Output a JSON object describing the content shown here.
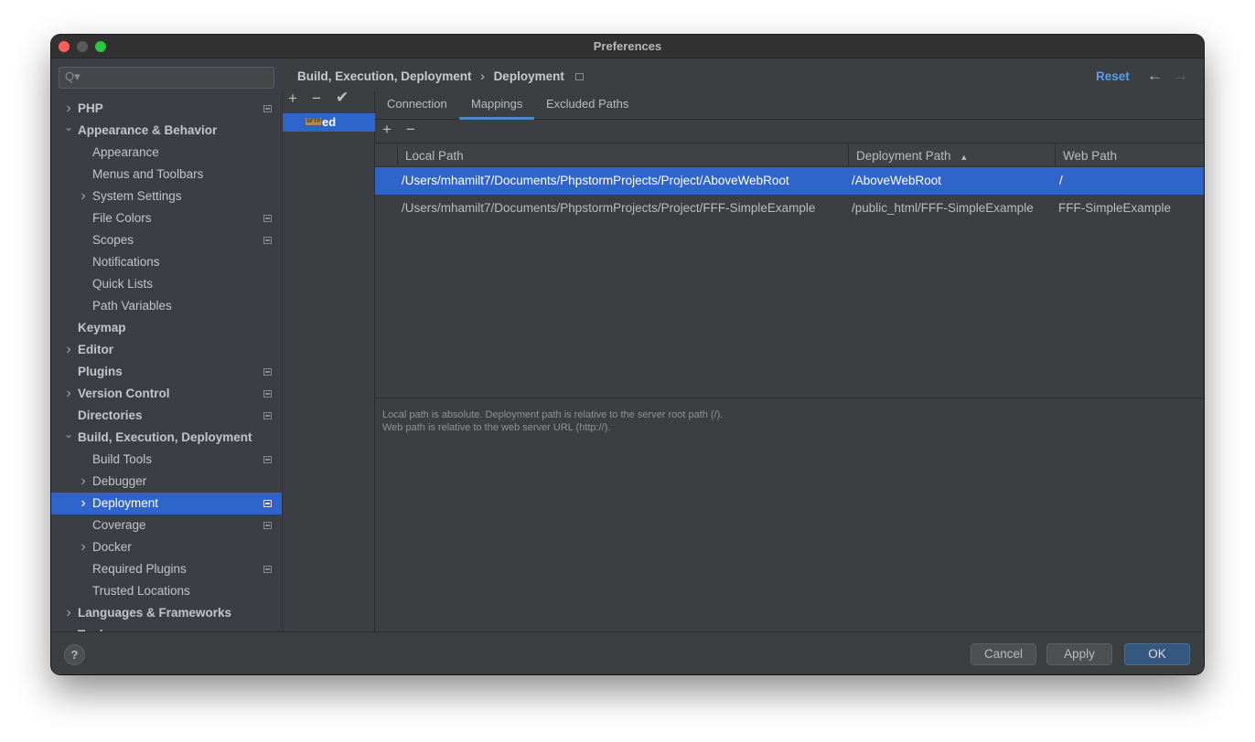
{
  "window": {
    "title": "Preferences"
  },
  "search": {
    "placeholder": "Q▾"
  },
  "sidebar": {
    "items": [
      {
        "label": "PHP",
        "level": 0,
        "arrow": ">",
        "bold": true,
        "badge": true
      },
      {
        "label": "Appearance & Behavior",
        "level": 0,
        "arrow": "v",
        "bold": true,
        "badge": false
      },
      {
        "label": "Appearance",
        "level": 1,
        "arrow": "",
        "bold": false,
        "badge": false
      },
      {
        "label": "Menus and Toolbars",
        "level": 1,
        "arrow": "",
        "bold": false,
        "badge": false
      },
      {
        "label": "System Settings",
        "level": 1,
        "arrow": ">",
        "bold": false,
        "badge": false
      },
      {
        "label": "File Colors",
        "level": 1,
        "arrow": "",
        "bold": false,
        "badge": true
      },
      {
        "label": "Scopes",
        "level": 1,
        "arrow": "",
        "bold": false,
        "badge": true
      },
      {
        "label": "Notifications",
        "level": 1,
        "arrow": "",
        "bold": false,
        "badge": false
      },
      {
        "label": "Quick Lists",
        "level": 1,
        "arrow": "",
        "bold": false,
        "badge": false
      },
      {
        "label": "Path Variables",
        "level": 1,
        "arrow": "",
        "bold": false,
        "badge": false
      },
      {
        "label": "Keymap",
        "level": 0,
        "arrow": "",
        "bold": true,
        "badge": false
      },
      {
        "label": "Editor",
        "level": 0,
        "arrow": ">",
        "bold": true,
        "badge": false
      },
      {
        "label": "Plugins",
        "level": 0,
        "arrow": "",
        "bold": true,
        "badge": true
      },
      {
        "label": "Version Control",
        "level": 0,
        "arrow": ">",
        "bold": true,
        "badge": true
      },
      {
        "label": "Directories",
        "level": 0,
        "arrow": "",
        "bold": true,
        "badge": true
      },
      {
        "label": "Build, Execution, Deployment",
        "level": 0,
        "arrow": "v",
        "bold": true,
        "badge": false
      },
      {
        "label": "Build Tools",
        "level": 1,
        "arrow": "",
        "bold": false,
        "badge": true
      },
      {
        "label": "Debugger",
        "level": 1,
        "arrow": ">",
        "bold": false,
        "badge": false
      },
      {
        "label": "Deployment",
        "level": 1,
        "arrow": ">",
        "bold": false,
        "badge": true,
        "selected": true
      },
      {
        "label": "Coverage",
        "level": 1,
        "arrow": "",
        "bold": false,
        "badge": true
      },
      {
        "label": "Docker",
        "level": 1,
        "arrow": ">",
        "bold": false,
        "badge": false
      },
      {
        "label": "Required Plugins",
        "level": 1,
        "arrow": "",
        "bold": false,
        "badge": true
      },
      {
        "label": "Trusted Locations",
        "level": 1,
        "arrow": "",
        "bold": false,
        "badge": false
      },
      {
        "label": "Languages & Frameworks",
        "level": 0,
        "arrow": ">",
        "bold": true,
        "badge": false
      },
      {
        "label": "Tools",
        "level": 0,
        "arrow": ">",
        "bold": true,
        "badge": false
      }
    ]
  },
  "breadcrumb": {
    "parent": "Build, Execution, Deployment",
    "sep": "›",
    "current": "Deployment"
  },
  "header": {
    "reset": "Reset",
    "back": "←",
    "forward": "→"
  },
  "servers": {
    "add": "+",
    "remove": "−",
    "default": "✔",
    "items": [
      {
        "name": "ed",
        "type": "SFTP"
      }
    ]
  },
  "tabs": [
    {
      "label": "Connection"
    },
    {
      "label": "Mappings",
      "active": true
    },
    {
      "label": "Excluded Paths"
    }
  ],
  "mappings": {
    "add": "+",
    "remove": "−",
    "columns": [
      "Local Path",
      "Deployment Path",
      "Web Path"
    ],
    "sort_indicator": "▲",
    "rows": [
      {
        "local": "/Users/mhamilt7/Documents/PhpstormProjects/Project/AboveWebRoot",
        "deployment": "/AboveWebRoot",
        "web": "/",
        "selected": true
      },
      {
        "local": "/Users/mhamilt7/Documents/PhpstormProjects/Project/FFF-SimpleExample",
        "deployment": "/public_html/FFF-SimpleExample",
        "web": "FFF-SimpleExample"
      }
    ],
    "hint1": "Local path is absolute. Deployment path is relative to the server root path (/).",
    "hint2": "Web path is relative to the web server URL (http://)."
  },
  "footer": {
    "help": "?",
    "cancel": "Cancel",
    "apply": "Apply",
    "ok": "OK"
  },
  "colors": {
    "accent": "#2f65ca",
    "link": "#589df6"
  }
}
